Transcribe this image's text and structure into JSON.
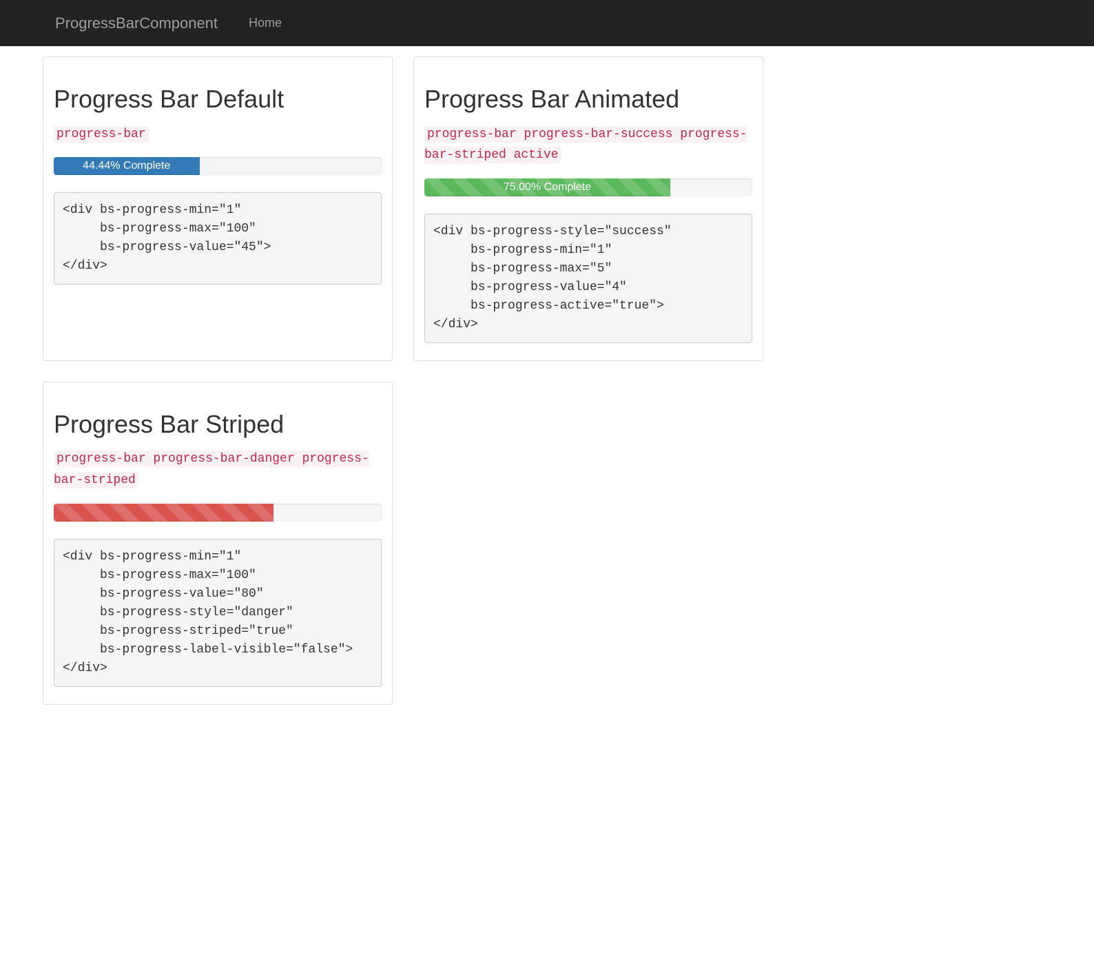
{
  "navbar": {
    "brand": "ProgressBarComponent",
    "link_home": "Home"
  },
  "panels": {
    "default": {
      "title": "Progress Bar Default",
      "class_code": "progress-bar",
      "percent": 44.44,
      "label": "44.44% Complete",
      "code": "<div bs-progress-min=\"1\"\n     bs-progress-max=\"100\"\n     bs-progress-value=\"45\">\n</div>"
    },
    "animated": {
      "title": "Progress Bar Animated",
      "class_code": "progress-bar progress-bar-success progress-bar-striped active",
      "percent": 75.0,
      "label": "75.00% Complete",
      "code": "<div bs-progress-style=\"success\"\n     bs-progress-min=\"1\"\n     bs-progress-max=\"5\"\n     bs-progress-value=\"4\"\n     bs-progress-active=\"true\">\n</div>"
    },
    "striped": {
      "title": "Progress Bar Striped",
      "class_code": "progress-bar progress-bar-danger progress-bar-striped",
      "percent": 67,
      "label": "",
      "code": "<div bs-progress-min=\"1\"\n     bs-progress-max=\"100\"\n     bs-progress-value=\"80\"\n     bs-progress-style=\"danger\"\n     bs-progress-striped=\"true\"\n     bs-progress-label-visible=\"false\">\n</div>"
    }
  },
  "colors": {
    "primary": "#337ab7",
    "success": "#5cb85c",
    "danger": "#d9534f",
    "navbar_bg": "#222",
    "code_text": "#c7254e",
    "code_bg": "#f9f2f4"
  }
}
